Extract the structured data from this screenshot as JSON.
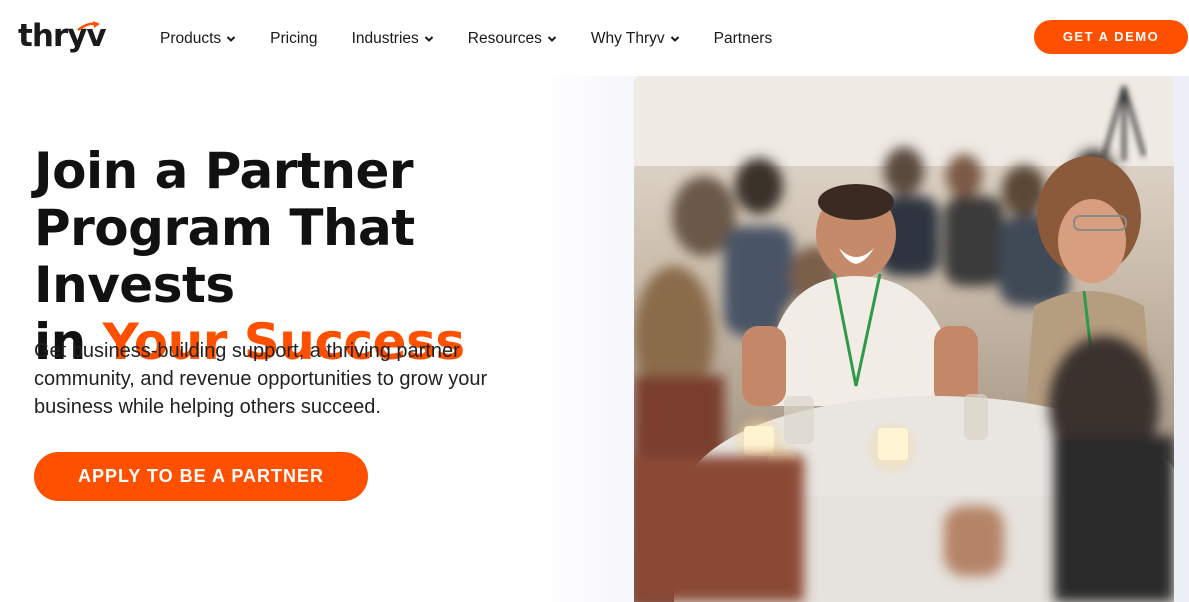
{
  "header": {
    "logo_text": "thryv",
    "nav": [
      {
        "label": "Products",
        "has_dropdown": true
      },
      {
        "label": "Pricing",
        "has_dropdown": false
      },
      {
        "label": "Industries",
        "has_dropdown": true
      },
      {
        "label": "Resources",
        "has_dropdown": true
      },
      {
        "label": "Why Thryv",
        "has_dropdown": true
      },
      {
        "label": "Partners",
        "has_dropdown": false
      }
    ],
    "cta_label": "GET A DEMO"
  },
  "hero": {
    "title_line1": "Join a Partner",
    "title_line2": "Program That Invests",
    "title_line3_prefix": "in ",
    "title_line3_accent": "Your Success",
    "subtitle": "Get business-building support, a thriving partner community, and revenue opportunities to grow your business while helping others succeed.",
    "cta_label": "APPLY TO BE A PARTNER"
  },
  "colors": {
    "brand_orange": "#ff5000",
    "text_dark": "#111111"
  },
  "icons": {
    "dropdown": "chevron-down-icon",
    "logo_mark": "arrow-icon"
  }
}
